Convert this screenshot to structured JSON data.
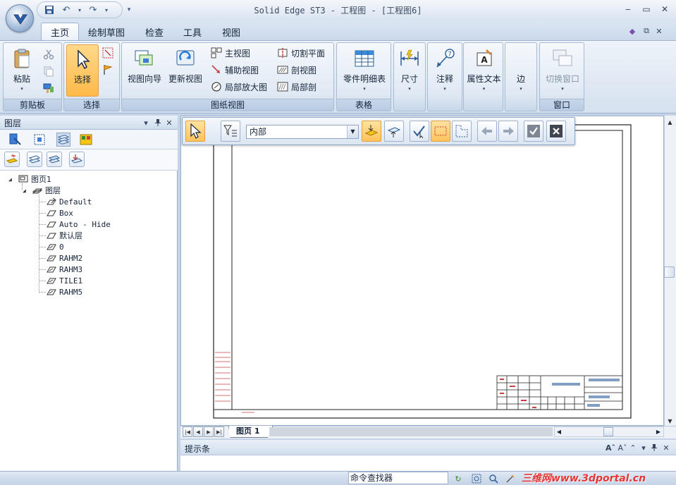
{
  "window": {
    "title": "Solid Edge ST3 - 工程图 - [工程图6]",
    "minimize": "‒",
    "restore": "▭",
    "close": "✕"
  },
  "quick_access": {
    "save_icon": "save-icon",
    "undo_icon": "undo-icon",
    "redo_icon": "redo-icon",
    "customize_icon": "▾"
  },
  "ribbon_tabs": [
    {
      "label": "主页",
      "active": true
    },
    {
      "label": "绘制草图"
    },
    {
      "label": "检查"
    },
    {
      "label": "工具"
    },
    {
      "label": "视图"
    }
  ],
  "ribbon_right": {
    "help": "◆",
    "restore": "⧉",
    "close": "✕"
  },
  "groups": {
    "clipboard": {
      "label": "剪贴板",
      "paste": "粘贴",
      "cut_icon": "scissors-icon",
      "copy_icon": "copy-icon",
      "format_icon": "format-painter-icon"
    },
    "select": {
      "label": "选择",
      "select": "选择"
    },
    "drawing_views": {
      "label": "图纸视图",
      "view_wizard": "视图向导",
      "update_views": "更新视图",
      "principal_view": "主视图",
      "auxiliary_view": "辅助视图",
      "detail_view": "局部放大图",
      "cutting_plane": "切割平面",
      "section_view": "剖视图",
      "broken_out": "局部剖"
    },
    "tables": {
      "label": "表格",
      "parts_list": "零件明细表"
    },
    "dimension": {
      "label": "尺寸"
    },
    "annotation": {
      "label": "注释"
    },
    "property_text": {
      "label": "属性文本"
    },
    "edge": {
      "label": "边"
    },
    "window": {
      "label": "窗口",
      "switch_window": "切换窗口"
    }
  },
  "left_panel": {
    "title": "图层",
    "pin": "▾",
    "dock": "ᵖ",
    "close": "✕",
    "tree": [
      {
        "label": "图页1",
        "level": 0,
        "toggle": "◢"
      },
      {
        "label": "图层",
        "level": 1,
        "toggle": "◢"
      },
      {
        "label": "Default",
        "level": 2
      },
      {
        "label": "Box",
        "level": 2
      },
      {
        "label": "Auto - Hide",
        "level": 2
      },
      {
        "label": "默认层",
        "level": 2
      },
      {
        "label": "0",
        "level": 2
      },
      {
        "label": "RAHM2",
        "level": 2
      },
      {
        "label": "RAHM3",
        "level": 2
      },
      {
        "label": "TILE1",
        "level": 2
      },
      {
        "label": "RAHM5",
        "level": 2
      }
    ]
  },
  "command_bar": {
    "filter_combo": "内部"
  },
  "sheet": {
    "tab": "图页 1"
  },
  "prompt_bar": {
    "title": "提示条",
    "font_up": "Aˆ",
    "font_down": "Aˇ"
  },
  "status_bar": {
    "command_finder": "命令查找器",
    "watermark": "三维网www.3dportal.cn"
  },
  "colors": {
    "ribbon_bg": "#d5e1ef",
    "selected_button": "#ffb94a",
    "accent": "#3d5a82",
    "watermark": "#e53535"
  }
}
